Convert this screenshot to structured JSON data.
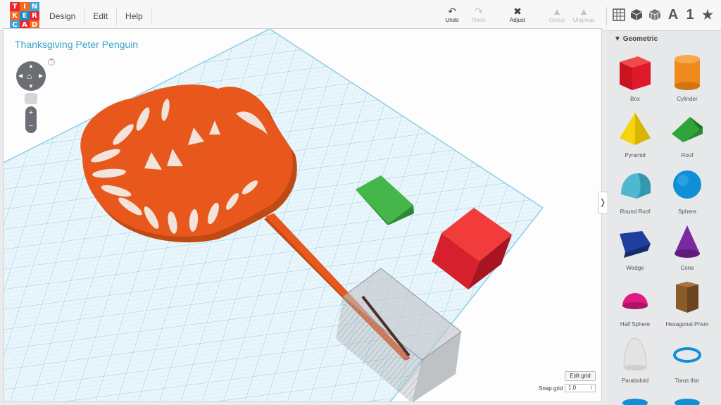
{
  "logo": {
    "letters": [
      "T",
      "I",
      "N",
      "K",
      "E",
      "R",
      "C",
      "A",
      "D"
    ]
  },
  "menu": {
    "design": "Design",
    "edit": "Edit",
    "help": "Help"
  },
  "toolbar": {
    "undo": "Undo",
    "redo": "Redo",
    "adjust": "Adjust",
    "group": "Group",
    "ungroup": "Ungroup"
  },
  "view_tools": {
    "text_icon": "A",
    "number_icon": "1"
  },
  "design": {
    "title": "Thanksgiving Peter Penguin"
  },
  "workplane": {
    "edit_grid": "Edit grid",
    "snap_label": "Snap grid",
    "snap_value": "1.0",
    "help": "?"
  },
  "sidebar": {
    "header": "Geometric",
    "shapes": [
      {
        "label": "Box",
        "icon": "box-icon",
        "color": "#e0192a"
      },
      {
        "label": "Cylinder",
        "icon": "cylinder-icon",
        "color": "#f08a1c"
      },
      {
        "label": "Pyramid",
        "icon": "pyramid-icon",
        "color": "#f5d40e"
      },
      {
        "label": "Roof",
        "icon": "roof-icon",
        "color": "#2ea43a"
      },
      {
        "label": "Round Roof",
        "icon": "round-roof-icon",
        "color": "#4fb8d0"
      },
      {
        "label": "Sphere",
        "icon": "sphere-icon",
        "color": "#0f8fd6"
      },
      {
        "label": "Wedge",
        "icon": "wedge-icon",
        "color": "#1f3e9e"
      },
      {
        "label": "Cone",
        "icon": "cone-icon",
        "color": "#7a2a9e"
      },
      {
        "label": "Half Sphere",
        "icon": "half-sphere-icon",
        "color": "#e01a82"
      },
      {
        "label": "Hexagonal Prism",
        "icon": "hexagonal-prism-icon",
        "color": "#8b5a2b"
      },
      {
        "label": "Paraboloid",
        "icon": "paraboloid-icon",
        "color": "#e0e0e0"
      },
      {
        "label": "Torus thin",
        "icon": "torus-icon",
        "color": "#0f8fd6"
      }
    ]
  },
  "colors": {
    "accent": "#3aa3c9",
    "orange_model": "#e8581c",
    "grid": "#b8dff0"
  }
}
